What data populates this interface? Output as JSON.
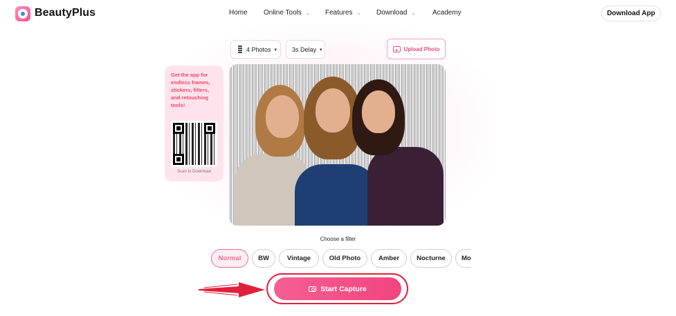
{
  "header": {
    "brand": "BeautyPlus",
    "nav": [
      {
        "label": "Home",
        "has_dropdown": false
      },
      {
        "label": "Online Tools",
        "has_dropdown": true
      },
      {
        "label": "Features",
        "has_dropdown": true
      },
      {
        "label": "Download",
        "has_dropdown": true
      },
      {
        "label": "Academy",
        "has_dropdown": false
      }
    ],
    "download_app": "Download App"
  },
  "controls": {
    "photos_select": "4 Photos",
    "delay_select": "3s Delay",
    "upload_photo": "Upload Photo"
  },
  "promo": {
    "text": "Get the app for endless frames, stickers, filters, and retouching tools!",
    "scan_label": "Scan to Download"
  },
  "filters": {
    "title": "Choose a filter",
    "items": [
      "Normal",
      "BW",
      "Vintage",
      "Old Photo",
      "Amber",
      "Nocturne",
      "Mo"
    ],
    "selected": "Normal"
  },
  "capture": {
    "label": "Start Capture"
  },
  "colors": {
    "accent": "#f2457f",
    "annotation_red": "#e0203a",
    "promo_bg": "#ffe3ec"
  },
  "icons": {
    "logo": "beautyplus-logo-icon",
    "photos": "grid-strip-icon",
    "upload": "image-icon",
    "capture": "camera-icon",
    "annotation": "red-arrow-icon"
  }
}
